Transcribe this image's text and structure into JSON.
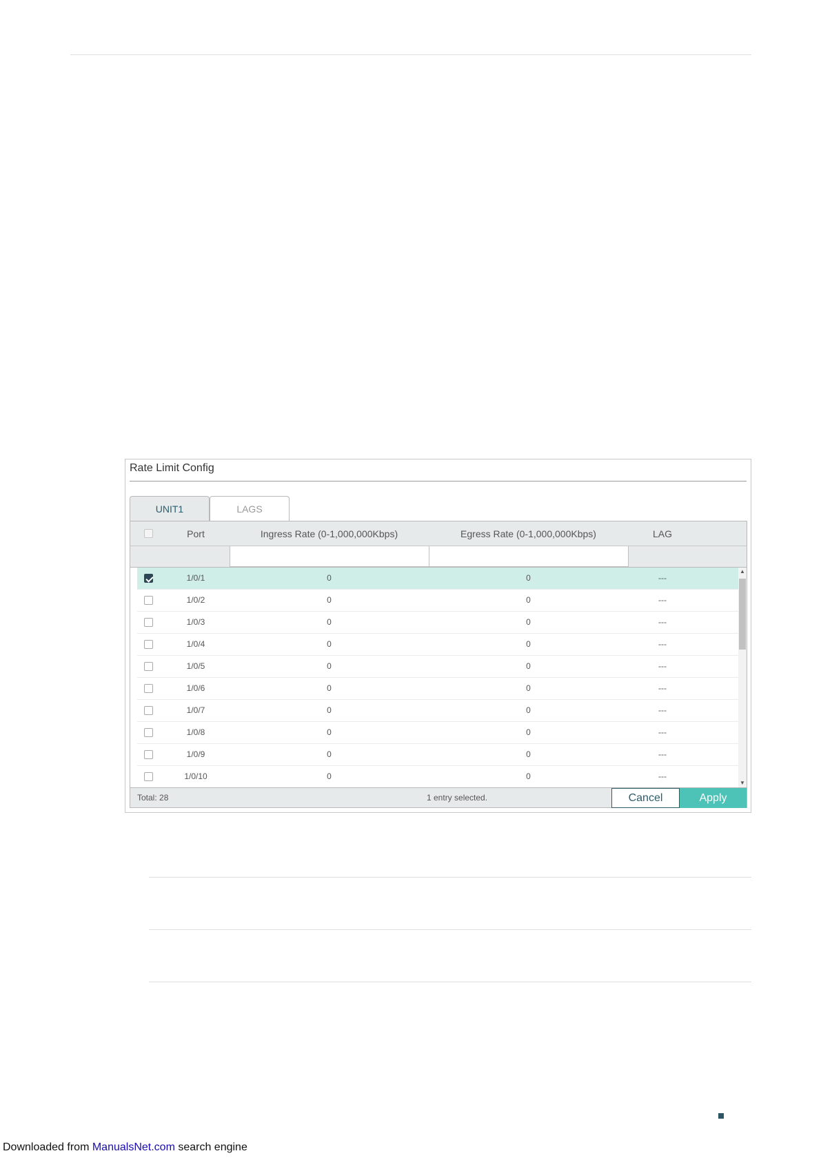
{
  "panel": {
    "title": "Rate Limit Config",
    "tabs": [
      {
        "label": "UNIT1",
        "active": true
      },
      {
        "label": "LAGS",
        "active": false
      }
    ],
    "columns": {
      "port": "Port",
      "ingress": "Ingress Rate (0-1,000,000Kbps)",
      "egress": "Egress Rate (0-1,000,000Kbps)",
      "lag": "LAG"
    },
    "filter": {
      "ingress_value": "",
      "egress_value": ""
    },
    "rows": [
      {
        "port": "1/0/1",
        "ingress": "0",
        "egress": "0",
        "lag": "---",
        "checked": true
      },
      {
        "port": "1/0/2",
        "ingress": "0",
        "egress": "0",
        "lag": "---",
        "checked": false
      },
      {
        "port": "1/0/3",
        "ingress": "0",
        "egress": "0",
        "lag": "---",
        "checked": false
      },
      {
        "port": "1/0/4",
        "ingress": "0",
        "egress": "0",
        "lag": "---",
        "checked": false
      },
      {
        "port": "1/0/5",
        "ingress": "0",
        "egress": "0",
        "lag": "---",
        "checked": false
      },
      {
        "port": "1/0/6",
        "ingress": "0",
        "egress": "0",
        "lag": "---",
        "checked": false
      },
      {
        "port": "1/0/7",
        "ingress": "0",
        "egress": "0",
        "lag": "---",
        "checked": false
      },
      {
        "port": "1/0/8",
        "ingress": "0",
        "egress": "0",
        "lag": "---",
        "checked": false
      },
      {
        "port": "1/0/9",
        "ingress": "0",
        "egress": "0",
        "lag": "---",
        "checked": false
      },
      {
        "port": "1/0/10",
        "ingress": "0",
        "egress": "0",
        "lag": "---",
        "checked": false
      }
    ],
    "footer": {
      "total": "Total: 28",
      "selected": "1 entry selected.",
      "cancel_label": "Cancel",
      "apply_label": "Apply"
    }
  },
  "page_footer": {
    "prefix": "Downloaded from ",
    "link": "ManualsNet.com",
    "suffix": " search engine"
  },
  "colors": {
    "accent": "#4dc2b7",
    "selected_row": "#cfeee8",
    "header_bg": "#e7eaea",
    "dark": "#2e4756",
    "link": "#1a0dab"
  }
}
